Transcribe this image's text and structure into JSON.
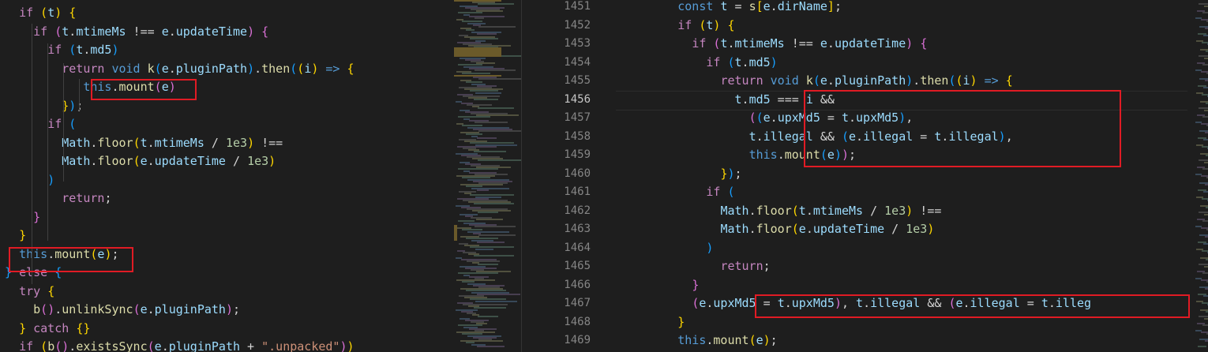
{
  "left": {
    "lines": [
      [
        [
          "  ",
          "op"
        ],
        [
          "if",
          "ctl"
        ],
        [
          " ",
          "op"
        ],
        [
          "(",
          "b1"
        ],
        [
          "t",
          "var"
        ],
        [
          ")",
          "b1"
        ],
        [
          " ",
          "op"
        ],
        [
          "{",
          "b1"
        ]
      ],
      [
        [
          "    ",
          "op"
        ],
        [
          "if",
          "ctl"
        ],
        [
          " ",
          "op"
        ],
        [
          "(",
          "b2"
        ],
        [
          "t",
          "var"
        ],
        [
          ".",
          "op"
        ],
        [
          "mtimeMs",
          "var"
        ],
        [
          " !== ",
          "op"
        ],
        [
          "e",
          "var"
        ],
        [
          ".",
          "op"
        ],
        [
          "updateTime",
          "var"
        ],
        [
          ")",
          "b2"
        ],
        [
          " ",
          "op"
        ],
        [
          "{",
          "b2"
        ]
      ],
      [
        [
          "      ",
          "op"
        ],
        [
          "if",
          "ctl"
        ],
        [
          " ",
          "op"
        ],
        [
          "(",
          "b3"
        ],
        [
          "t",
          "var"
        ],
        [
          ".",
          "op"
        ],
        [
          "md5",
          "var"
        ],
        [
          ")",
          "b3"
        ]
      ],
      [
        [
          "        ",
          "op"
        ],
        [
          "return",
          "ctl"
        ],
        [
          " ",
          "op"
        ],
        [
          "void",
          "kw"
        ],
        [
          " ",
          "op"
        ],
        [
          "k",
          "fn"
        ],
        [
          "(",
          "b3"
        ],
        [
          "e",
          "var"
        ],
        [
          ".",
          "op"
        ],
        [
          "pluginPath",
          "var"
        ],
        [
          ")",
          "b3"
        ],
        [
          ".",
          "op"
        ],
        [
          "then",
          "fn"
        ],
        [
          "(",
          "b3"
        ],
        [
          "(",
          "b1"
        ],
        [
          "i",
          "var"
        ],
        [
          ")",
          "b1"
        ],
        [
          " ",
          "op"
        ],
        [
          "=>",
          "kw"
        ],
        [
          " ",
          "op"
        ],
        [
          "{",
          "b1"
        ]
      ],
      [
        [
          "           ",
          "op"
        ],
        [
          "this",
          "kw"
        ],
        [
          ".",
          "op"
        ],
        [
          "mount",
          "fn"
        ],
        [
          "(",
          "b2"
        ],
        [
          "e",
          "var"
        ],
        [
          ")",
          "b2"
        ]
      ],
      [
        [
          "        ",
          "op"
        ],
        [
          "}",
          "b1"
        ],
        [
          ")",
          "b3"
        ],
        [
          ";",
          "op"
        ]
      ],
      [
        [
          "      ",
          "op"
        ],
        [
          "if",
          "ctl"
        ],
        [
          " ",
          "op"
        ],
        [
          "(",
          "b3"
        ]
      ],
      [
        [
          "        ",
          "op"
        ],
        [
          "Math",
          "var"
        ],
        [
          ".",
          "op"
        ],
        [
          "floor",
          "fn"
        ],
        [
          "(",
          "b1"
        ],
        [
          "t",
          "var"
        ],
        [
          ".",
          "op"
        ],
        [
          "mtimeMs",
          "var"
        ],
        [
          " / ",
          "op"
        ],
        [
          "1e3",
          "num"
        ],
        [
          ")",
          "b1"
        ],
        [
          " !==",
          "op"
        ]
      ],
      [
        [
          "        ",
          "op"
        ],
        [
          "Math",
          "var"
        ],
        [
          ".",
          "op"
        ],
        [
          "floor",
          "fn"
        ],
        [
          "(",
          "b1"
        ],
        [
          "e",
          "var"
        ],
        [
          ".",
          "op"
        ],
        [
          "updateTime",
          "var"
        ],
        [
          " / ",
          "op"
        ],
        [
          "1e3",
          "num"
        ],
        [
          ")",
          "b1"
        ]
      ],
      [
        [
          "      ",
          "op"
        ],
        [
          ")",
          "b3"
        ]
      ],
      [
        [
          "        ",
          "op"
        ],
        [
          "return",
          "ctl"
        ],
        [
          ";",
          "op"
        ]
      ],
      [
        [
          "    ",
          "op"
        ],
        [
          "}",
          "b2"
        ]
      ],
      [
        [
          "  ",
          "op"
        ],
        [
          "}",
          "b1"
        ]
      ],
      [
        [
          "  ",
          "op"
        ],
        [
          "this",
          "kw"
        ],
        [
          ".",
          "op"
        ],
        [
          "mount",
          "fn"
        ],
        [
          "(",
          "b1"
        ],
        [
          "e",
          "var"
        ],
        [
          ")",
          "b1"
        ],
        [
          ";",
          "op"
        ]
      ],
      [
        [
          "} ",
          "b3"
        ],
        [
          "else",
          "ctl"
        ],
        [
          " ",
          "op"
        ],
        [
          "{",
          "b3"
        ]
      ],
      [
        [
          "  ",
          "op"
        ],
        [
          "try",
          "ctl"
        ],
        [
          " ",
          "op"
        ],
        [
          "{",
          "b1"
        ]
      ],
      [
        [
          "    ",
          "op"
        ],
        [
          "b",
          "fn"
        ],
        [
          "(",
          "b2"
        ],
        [
          ")",
          "b2"
        ],
        [
          ".",
          "op"
        ],
        [
          "unlinkSync",
          "fn"
        ],
        [
          "(",
          "b2"
        ],
        [
          "e",
          "var"
        ],
        [
          ".",
          "op"
        ],
        [
          "pluginPath",
          "var"
        ],
        [
          ")",
          "b2"
        ],
        [
          ";",
          "op"
        ]
      ],
      [
        [
          "  ",
          "op"
        ],
        [
          "}",
          "b1"
        ],
        [
          " ",
          "op"
        ],
        [
          "catch",
          "ctl"
        ],
        [
          " ",
          "op"
        ],
        [
          "{}",
          "b1"
        ]
      ],
      [
        [
          "  ",
          "op"
        ],
        [
          "if",
          "ctl"
        ],
        [
          " ",
          "op"
        ],
        [
          "(",
          "b1"
        ],
        [
          "b",
          "fn"
        ],
        [
          "(",
          "b2"
        ],
        [
          ")",
          "b2"
        ],
        [
          ".",
          "op"
        ],
        [
          "existsSync",
          "fn"
        ],
        [
          "(",
          "b2"
        ],
        [
          "e",
          "var"
        ],
        [
          ".",
          "op"
        ],
        [
          "pluginPath",
          "var"
        ],
        [
          " + ",
          "op"
        ],
        [
          "\".unpacked\"",
          "str"
        ],
        [
          ")",
          "b2"
        ],
        [
          ")",
          "b1"
        ]
      ]
    ]
  },
  "right": {
    "line_numbers": [
      "1451",
      "1452",
      "1453",
      "1454",
      "1455",
      "1456",
      "1457",
      "1458",
      "1459",
      "1460",
      "1461",
      "1462",
      "1463",
      "1464",
      "1465",
      "1466",
      "1467",
      "1468",
      "1469"
    ],
    "active_line": "1456",
    "lines": [
      [
        [
          "        ",
          "op"
        ],
        [
          "const",
          "kw"
        ],
        [
          " ",
          "op"
        ],
        [
          "t",
          "var"
        ],
        [
          " = ",
          "op"
        ],
        [
          "s",
          "fn"
        ],
        [
          "[",
          "b1"
        ],
        [
          "e",
          "var"
        ],
        [
          ".",
          "op"
        ],
        [
          "dirName",
          "var"
        ],
        [
          "]",
          "b1"
        ],
        [
          ";",
          "op"
        ]
      ],
      [
        [
          "        ",
          "op"
        ],
        [
          "if",
          "ctl"
        ],
        [
          " ",
          "op"
        ],
        [
          "(",
          "b1"
        ],
        [
          "t",
          "var"
        ],
        [
          ")",
          "b1"
        ],
        [
          " ",
          "op"
        ],
        [
          "{",
          "b1"
        ]
      ],
      [
        [
          "          ",
          "op"
        ],
        [
          "if",
          "ctl"
        ],
        [
          " ",
          "op"
        ],
        [
          "(",
          "b2"
        ],
        [
          "t",
          "var"
        ],
        [
          ".",
          "op"
        ],
        [
          "mtimeMs",
          "var"
        ],
        [
          " !== ",
          "op"
        ],
        [
          "e",
          "var"
        ],
        [
          ".",
          "op"
        ],
        [
          "updateTime",
          "var"
        ],
        [
          ")",
          "b2"
        ],
        [
          " ",
          "op"
        ],
        [
          "{",
          "b2"
        ]
      ],
      [
        [
          "            ",
          "op"
        ],
        [
          "if",
          "ctl"
        ],
        [
          " ",
          "op"
        ],
        [
          "(",
          "b3"
        ],
        [
          "t",
          "var"
        ],
        [
          ".",
          "op"
        ],
        [
          "md5",
          "var"
        ],
        [
          ")",
          "b3"
        ]
      ],
      [
        [
          "              ",
          "op"
        ],
        [
          "return",
          "ctl"
        ],
        [
          " ",
          "op"
        ],
        [
          "void",
          "kw"
        ],
        [
          " ",
          "op"
        ],
        [
          "k",
          "fn"
        ],
        [
          "(",
          "b3"
        ],
        [
          "e",
          "var"
        ],
        [
          ".",
          "op"
        ],
        [
          "pluginPath",
          "var"
        ],
        [
          ")",
          "b3"
        ],
        [
          ".",
          "op"
        ],
        [
          "then",
          "fn"
        ],
        [
          "(",
          "b3"
        ],
        [
          "(",
          "b1"
        ],
        [
          "i",
          "var"
        ],
        [
          ")",
          "b1"
        ],
        [
          " ",
          "op"
        ],
        [
          "=>",
          "kw"
        ],
        [
          " ",
          "op"
        ],
        [
          "{",
          "b1"
        ]
      ],
      [
        [
          "                ",
          "op"
        ],
        [
          "t",
          "var"
        ],
        [
          ".",
          "op"
        ],
        [
          "md5",
          "var"
        ],
        [
          " === ",
          "op"
        ],
        [
          "i",
          "var"
        ],
        [
          " &&",
          "op"
        ]
      ],
      [
        [
          "                  ",
          "op"
        ],
        [
          "(",
          "b2"
        ],
        [
          "(",
          "b3"
        ],
        [
          "e",
          "var"
        ],
        [
          ".",
          "op"
        ],
        [
          "upxMd5",
          "var"
        ],
        [
          " = ",
          "op"
        ],
        [
          "t",
          "var"
        ],
        [
          ".",
          "op"
        ],
        [
          "upxMd5",
          "var"
        ],
        [
          ")",
          "b3"
        ],
        [
          ",",
          "op"
        ]
      ],
      [
        [
          "                  ",
          "op"
        ],
        [
          "t",
          "var"
        ],
        [
          ".",
          "op"
        ],
        [
          "illegal",
          "var"
        ],
        [
          " && ",
          "op"
        ],
        [
          "(",
          "b3"
        ],
        [
          "e",
          "var"
        ],
        [
          ".",
          "op"
        ],
        [
          "illegal",
          "var"
        ],
        [
          " = ",
          "op"
        ],
        [
          "t",
          "var"
        ],
        [
          ".",
          "op"
        ],
        [
          "illegal",
          "var"
        ],
        [
          ")",
          "b3"
        ],
        [
          ",",
          "op"
        ]
      ],
      [
        [
          "                  ",
          "op"
        ],
        [
          "this",
          "kw"
        ],
        [
          ".",
          "op"
        ],
        [
          "mount",
          "fn"
        ],
        [
          "(",
          "b3"
        ],
        [
          "e",
          "var"
        ],
        [
          ")",
          "b3"
        ],
        [
          ")",
          "b2"
        ],
        [
          ";",
          "op"
        ]
      ],
      [
        [
          "              ",
          "op"
        ],
        [
          "}",
          "b1"
        ],
        [
          ")",
          "b3"
        ],
        [
          ";",
          "op"
        ]
      ],
      [
        [
          "            ",
          "op"
        ],
        [
          "if",
          "ctl"
        ],
        [
          " ",
          "op"
        ],
        [
          "(",
          "b3"
        ]
      ],
      [
        [
          "              ",
          "op"
        ],
        [
          "Math",
          "var"
        ],
        [
          ".",
          "op"
        ],
        [
          "floor",
          "fn"
        ],
        [
          "(",
          "b1"
        ],
        [
          "t",
          "var"
        ],
        [
          ".",
          "op"
        ],
        [
          "mtimeMs",
          "var"
        ],
        [
          " / ",
          "op"
        ],
        [
          "1e3",
          "num"
        ],
        [
          ")",
          "b1"
        ],
        [
          " !==",
          "op"
        ]
      ],
      [
        [
          "              ",
          "op"
        ],
        [
          "Math",
          "var"
        ],
        [
          ".",
          "op"
        ],
        [
          "floor",
          "fn"
        ],
        [
          "(",
          "b1"
        ],
        [
          "e",
          "var"
        ],
        [
          ".",
          "op"
        ],
        [
          "updateTime",
          "var"
        ],
        [
          " / ",
          "op"
        ],
        [
          "1e3",
          "num"
        ],
        [
          ")",
          "b1"
        ]
      ],
      [
        [
          "            ",
          "op"
        ],
        [
          ")",
          "b3"
        ]
      ],
      [
        [
          "              ",
          "op"
        ],
        [
          "return",
          "ctl"
        ],
        [
          ";",
          "op"
        ]
      ],
      [
        [
          "          ",
          "op"
        ],
        [
          "}",
          "b2"
        ]
      ],
      [
        [
          "          ",
          "op"
        ],
        [
          "(",
          "b2"
        ],
        [
          "e",
          "var"
        ],
        [
          ".",
          "op"
        ],
        [
          "upxMd5",
          "var"
        ],
        [
          " = ",
          "op"
        ],
        [
          "t",
          "var"
        ],
        [
          ".",
          "op"
        ],
        [
          "upxMd5",
          "var"
        ],
        [
          ")",
          "b2"
        ],
        [
          ", ",
          "op"
        ],
        [
          "t",
          "var"
        ],
        [
          ".",
          "op"
        ],
        [
          "illegal",
          "var"
        ],
        [
          " && ",
          "op"
        ],
        [
          "(",
          "b2"
        ],
        [
          "e",
          "var"
        ],
        [
          ".",
          "op"
        ],
        [
          "illegal",
          "var"
        ],
        [
          " = ",
          "op"
        ],
        [
          "t",
          "var"
        ],
        [
          ".",
          "op"
        ],
        [
          "illeg",
          "var"
        ]
      ],
      [
        [
          "        ",
          "op"
        ],
        [
          "}",
          "b1"
        ]
      ],
      [
        [
          "        ",
          "op"
        ],
        [
          "this",
          "kw"
        ],
        [
          ".",
          "op"
        ],
        [
          "mount",
          "fn"
        ],
        [
          "(",
          "b1"
        ],
        [
          "e",
          "var"
        ],
        [
          ")",
          "b1"
        ],
        [
          ";",
          "op"
        ]
      ]
    ]
  }
}
